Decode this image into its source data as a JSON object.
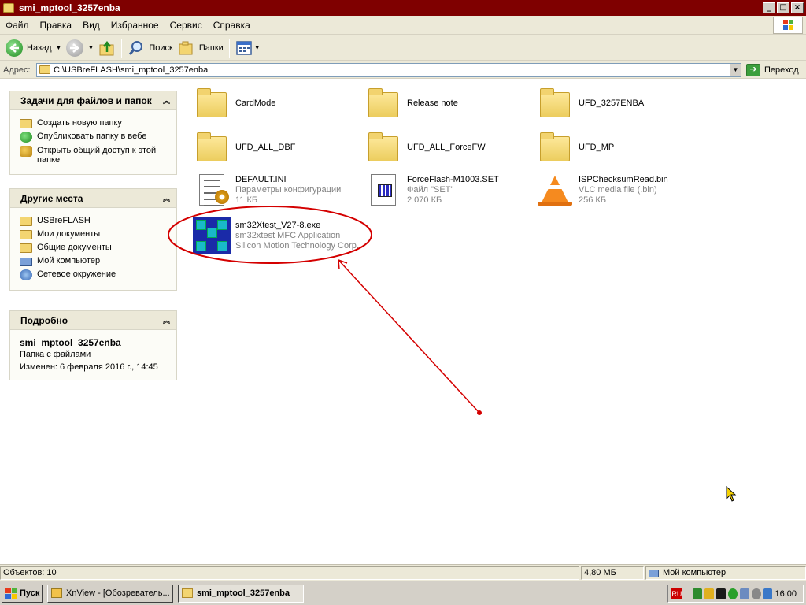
{
  "window": {
    "title": "smi_mptool_3257enba"
  },
  "menu": [
    "Файл",
    "Правка",
    "Вид",
    "Избранное",
    "Сервис",
    "Справка"
  ],
  "toolbar": {
    "back": "Назад",
    "search": "Поиск",
    "folders": "Папки"
  },
  "address": {
    "label": "Адрес:",
    "path": "C:\\USBreFLASH\\smi_mptool_3257enba",
    "go": "Переход"
  },
  "tasks_panel": {
    "title": "Задачи для файлов и папок",
    "items": [
      {
        "label": "Создать новую папку",
        "icon": "new-folder-icon"
      },
      {
        "label": "Опубликовать папку в вебе",
        "icon": "web-publish-icon"
      },
      {
        "label": "Открыть общий доступ к этой папке",
        "icon": "share-icon"
      }
    ]
  },
  "places_panel": {
    "title": "Другие места",
    "items": [
      {
        "label": "USBreFLASH",
        "icon": "folder-icon"
      },
      {
        "label": "Мои документы",
        "icon": "folder-icon"
      },
      {
        "label": "Общие документы",
        "icon": "folder-icon"
      },
      {
        "label": "Мой компьютер",
        "icon": "computer-icon"
      },
      {
        "label": "Сетевое окружение",
        "icon": "network-icon"
      }
    ]
  },
  "details_panel": {
    "title": "Подробно",
    "name": "smi_mptool_3257enba",
    "type": "Папка с файлами",
    "modified": "Изменен: 6 февраля 2016 г., 14:45"
  },
  "files": [
    {
      "name": "CardMode",
      "icon": "folder-icon"
    },
    {
      "name": "Release note",
      "icon": "folder-icon"
    },
    {
      "name": "UFD_3257ENBA",
      "icon": "folder-icon"
    },
    {
      "name": "UFD_ALL_DBF",
      "icon": "folder-icon"
    },
    {
      "name": "UFD_ALL_ForceFW",
      "icon": "folder-icon"
    },
    {
      "name": "UFD_MP",
      "icon": "folder-icon"
    },
    {
      "name": "DEFAULT.INI",
      "line2": "Параметры конфигурации",
      "line3": "11 КБ",
      "icon": "ini-file-icon"
    },
    {
      "name": "ForceFlash-M1003.SET",
      "line2": "Файл \"SET\"",
      "line3": "2 070 КБ",
      "icon": "set-file-icon"
    },
    {
      "name": "ISPChecksumRead.bin",
      "line2": "VLC media file (.bin)",
      "line3": "256 КБ",
      "icon": "vlc-cone-icon"
    },
    {
      "name": "sm32Xtest_V27-8.exe",
      "line2": "sm32xtest MFC Application",
      "line3": "Silicon Motion Technology Corp.",
      "icon": "exe-app-icon"
    }
  ],
  "status": {
    "objects": "Объектов: 10",
    "size": "4,80 МБ",
    "location": "Мой компьютер"
  },
  "taskbar": {
    "start": "Пуск",
    "tasks": [
      "XnView - [Обозреватель...",
      "smi_mptool_3257enba"
    ],
    "lang": "RU",
    "clock": "16:00"
  },
  "colors": {
    "titlebar": "#7f0000",
    "annotation": "#d40000",
    "chrome": "#ece9d8"
  }
}
